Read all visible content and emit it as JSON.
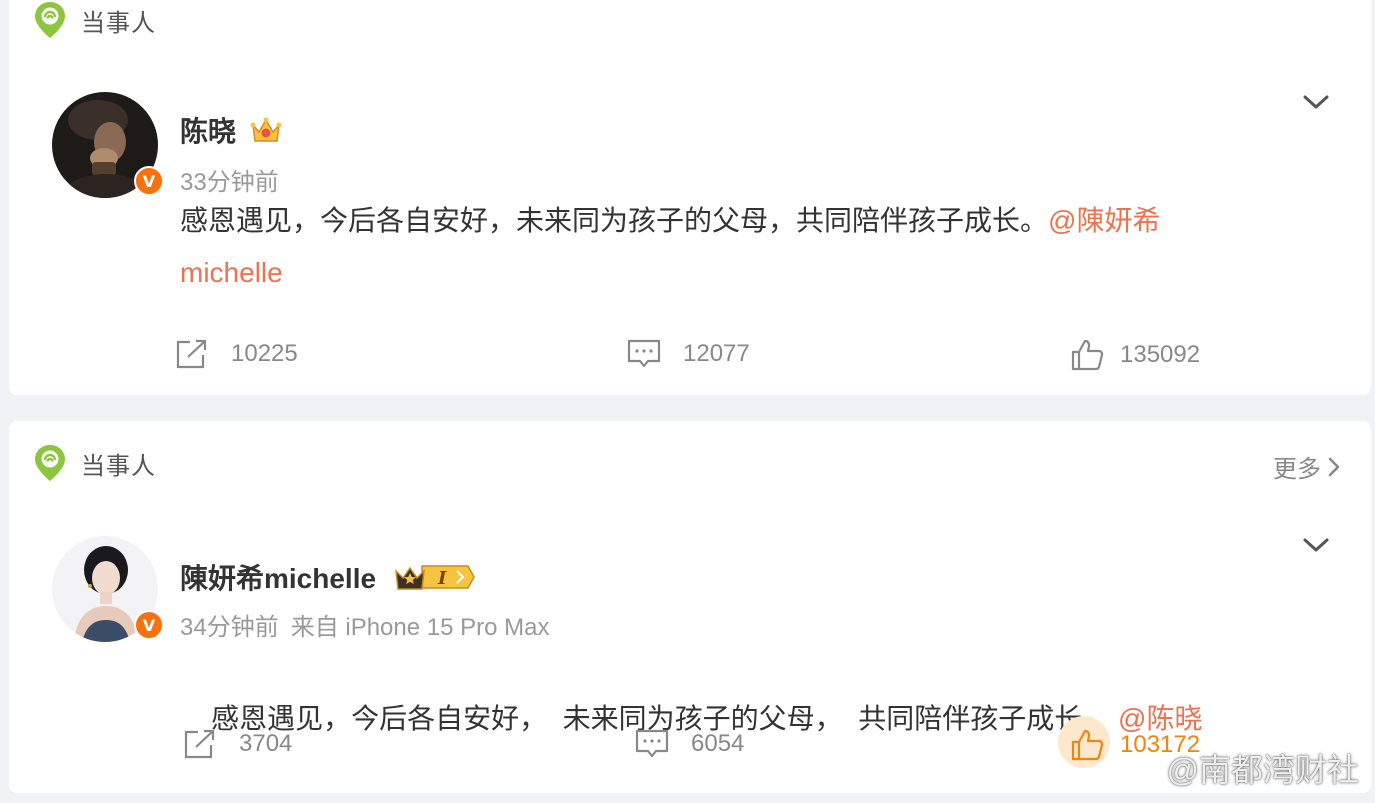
{
  "posts": [
    {
      "section_label": "当事人",
      "user_name": "陈晓",
      "time": "33分钟前",
      "source": "",
      "text": "感恩遇见，今后各自安好，未来同为孩子的父母，共同陪伴孩子成长。",
      "mention": "@陳妍希michelle",
      "reposts": "10225",
      "comments": "12077",
      "likes": "135092"
    },
    {
      "section_label": "当事人",
      "more_label": "更多",
      "user_name": "陳妍希michelle",
      "time": "34分钟前",
      "source": "来自 iPhone 15 Pro Max",
      "text": "感恩遇见，今后各自安好，  未来同为孩子的父母，  共同陪伴孩子成长 。",
      "mention": "@陈晓",
      "reposts": "3704",
      "comments": "6054",
      "likes": "103172"
    }
  ],
  "verified_badge_glyph": "V",
  "watermark": "@南都湾财社",
  "colors": {
    "accent_orange": "#f5720f",
    "mention": "#eb7350",
    "section_icon_green": "#8cc63f",
    "liked": "#f0840f"
  },
  "icons": {
    "section": "location-pin-icon",
    "repost": "repost-icon",
    "comment": "comment-icon",
    "like": "thumbs-up-icon",
    "expand": "chevron-down-icon",
    "crown": "crown-icon",
    "member": "member-level-icon",
    "weibo": "weibo-logo-icon"
  }
}
